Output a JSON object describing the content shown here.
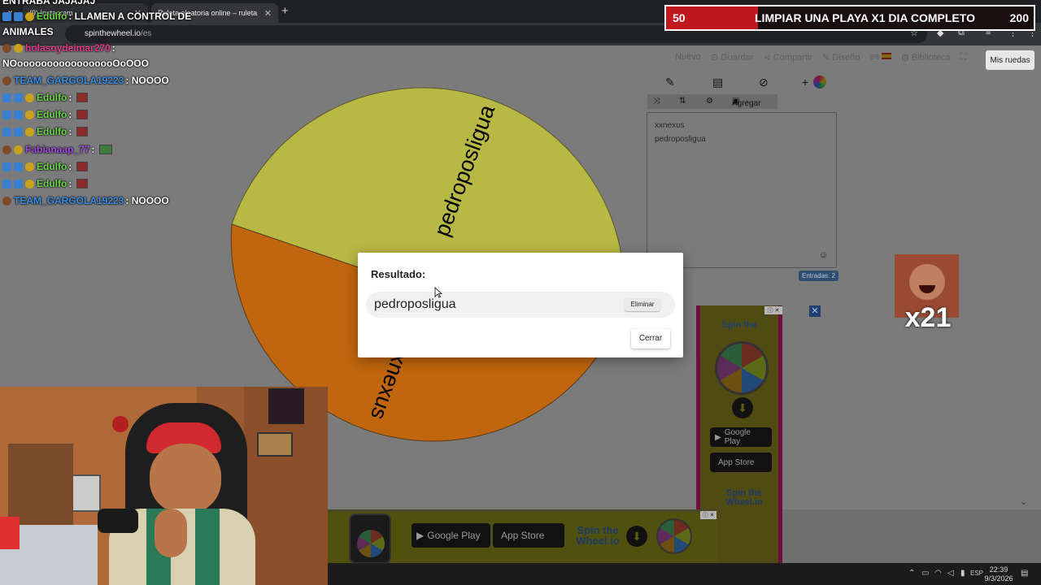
{
  "browser": {
    "tabs": [
      {
        "label": "(9) Instagram"
      },
      {
        "label": "Ruleta aleatoria online – ruleta"
      }
    ],
    "url": {
      "host": "spinthewheel.io",
      "path": "/es"
    }
  },
  "site": {
    "nav": {
      "new": "Nuevo",
      "save": "Guardar",
      "share": "Compartir",
      "design": "Diseño",
      "language": "es",
      "library": "Biblioteca",
      "my_wheels": "Mis ruedas"
    },
    "editor": {
      "add_label": "Agregar",
      "entries": [
        "xxnexus",
        "pedroposligua"
      ],
      "entry_count": "Entradas: 2"
    },
    "wheel": {
      "segments": [
        {
          "label": "pedroposligua",
          "color": "#b8b844"
        },
        {
          "label": "xxnexus",
          "color": "#c0660e"
        }
      ]
    }
  },
  "modal": {
    "title": "Resultado:",
    "result": "pedroposligua",
    "delete_label": "Eliminar",
    "close_label": "Cerrar"
  },
  "ads": {
    "google_play": "Google Play",
    "app_store": "App Store",
    "brand_line1": "Spin the",
    "brand_line2": "Wheel.io"
  },
  "stream": {
    "header_line1": "ENTRABA  JAJAJAJ",
    "header_line2_user": "Edulfo",
    "header_line2_msg": ": LLAMEN A CONTROL DE",
    "header_line3": "ANIMALES",
    "chat": [
      {
        "user": "holasoydeimar270",
        "msg": ":",
        "color": "pink"
      },
      {
        "user": "",
        "msg": "NOooooooooooooooooOoOOO",
        "color": "none"
      },
      {
        "user": "TEAM_GARGOLA19223",
        "msg": ": NOOOO",
        "color": "blue"
      },
      {
        "user": "Edulfo",
        "msg": ":",
        "color": "green"
      },
      {
        "user": "Edulfo",
        "msg": ":",
        "color": "green"
      },
      {
        "user": "Edulfo",
        "msg": ":",
        "color": "green"
      },
      {
        "user": "Fabianaap_77",
        "msg": ":",
        "color": "purple"
      },
      {
        "user": "Edulfo",
        "msg": ":",
        "color": "green"
      },
      {
        "user": "Edulfo",
        "msg": ":",
        "color": "green"
      },
      {
        "user": "TEAM_GARGOLA19223",
        "msg": ": NOOOO",
        "color": "blue"
      }
    ],
    "goal": {
      "current": "50",
      "text": "LIMPIAR UNA PLAYA X1 DIA COMPLETO",
      "target": "200",
      "progress": 0.25
    },
    "emote_multiplier": "x21"
  },
  "taskbar": {
    "lang": "ESP",
    "time": "22:39",
    "date": "9/3/2026"
  }
}
